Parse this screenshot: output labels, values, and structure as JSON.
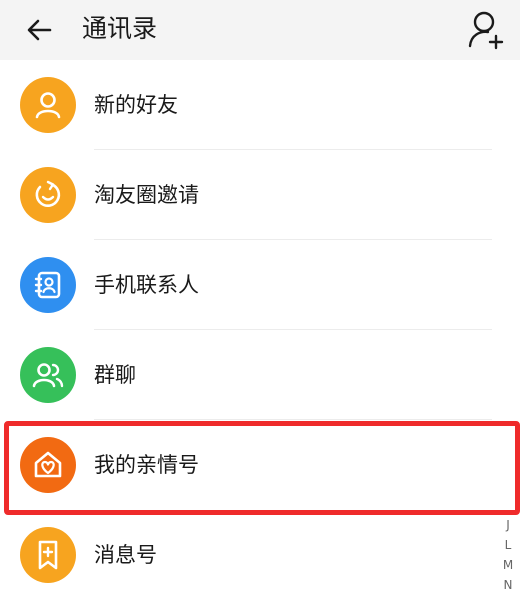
{
  "header": {
    "title": "通讯录",
    "back_icon": "arrow-left-icon",
    "add_icon": "add-friend-icon"
  },
  "colors": {
    "header_bg": "#f4f4f4",
    "orange": "#f7a41f",
    "blue": "#2f8ff0",
    "green": "#36c05a",
    "deep_orange": "#f26a12",
    "highlight_red": "#ef2b2b"
  },
  "items": [
    {
      "label": "新的好友",
      "icon": "person-icon",
      "color": "#f7a41f"
    },
    {
      "label": "淘友圈邀请",
      "icon": "refresh-smile-icon",
      "color": "#f7a41f"
    },
    {
      "label": "手机联系人",
      "icon": "phone-contact-icon",
      "color": "#2f8ff0"
    },
    {
      "label": "群聊",
      "icon": "group-chat-icon",
      "color": "#36c05a"
    },
    {
      "label": "我的亲情号",
      "icon": "home-heart-icon",
      "color": "#f26a12"
    },
    {
      "label": "消息号",
      "icon": "bookmark-plus-icon",
      "color": "#f7a41f"
    }
  ],
  "index_letters": [
    "J",
    "L",
    "M",
    "N"
  ]
}
